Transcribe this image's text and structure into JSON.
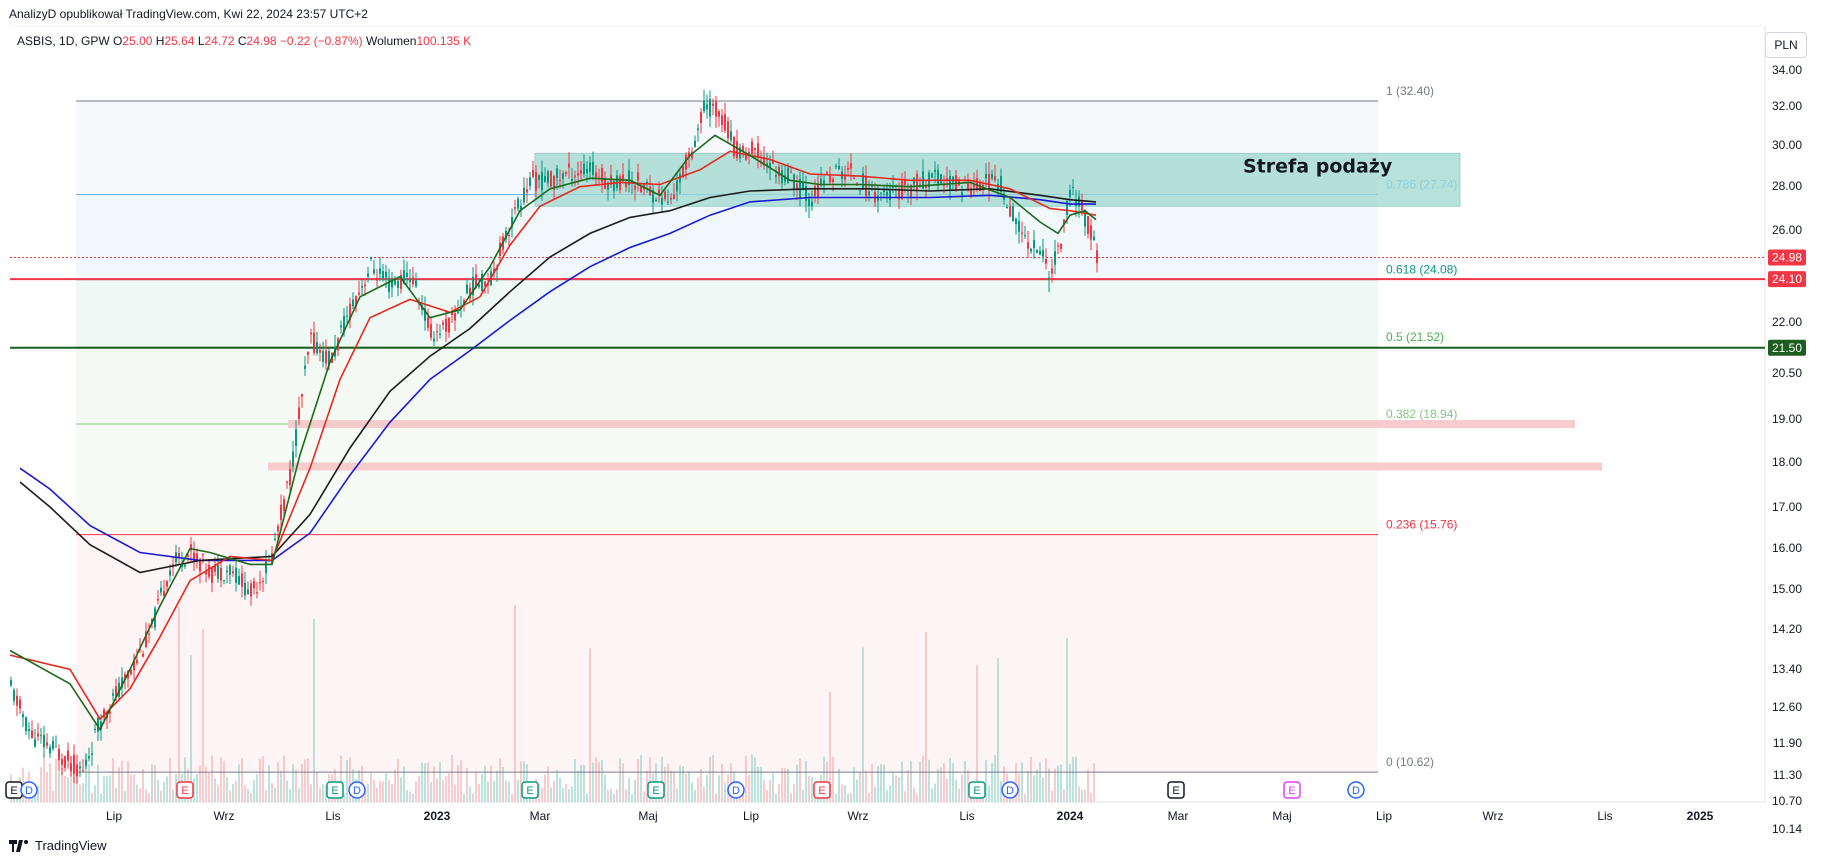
{
  "header": {
    "publisher_line": "AnalizyD opublikował TradingView.com, Kwi 22, 2024 23:57 UTC+2"
  },
  "symbol": {
    "name": "ASBIS, 1D, GPW",
    "open_label": "O",
    "open": "25.00",
    "high_label": "H",
    "high": "25.64",
    "low_label": "L",
    "low": "24.72",
    "close_label": "C",
    "close": "24.98",
    "change": "−0.22 (−0.87%)",
    "volume_label": "Wolumen",
    "volume": "100.135 K"
  },
  "currency": "PLN",
  "footer": {
    "brand": "TradingView"
  },
  "colors": {
    "up": "#089981",
    "down": "#f23645",
    "ema_green": "#1b6b1b",
    "ema_red": "#e8281e",
    "sma_black": "#1c1c1c",
    "sma_blue": "#1a1ad6",
    "zone": "#9fd8cf",
    "zone_border": "#7cc6ba"
  },
  "chart_data": {
    "type": "candlestick",
    "y_scale": "log",
    "y_ticks": [
      "34.00",
      "32.00",
      "30.00",
      "28.00",
      "26.00",
      "24.00",
      "22.00",
      "20.50",
      "19.00",
      "18.00",
      "17.00",
      "16.00",
      "15.00",
      "14.20",
      "13.40",
      "12.60",
      "11.90",
      "11.30",
      "10.70",
      "10.14"
    ],
    "x_ticks": [
      "Lip",
      "Wrz",
      "Lis",
      "2023",
      "Mar",
      "Maj",
      "Lip",
      "Wrz",
      "Lis",
      "2024",
      "Mar",
      "Maj",
      "Lip",
      "Wrz",
      "Lis",
      "2025"
    ],
    "fib_levels": [
      {
        "label": "1 (32.40)",
        "value": 32.4,
        "color": "#787b86"
      },
      {
        "label": "0.786 (27.74)",
        "value": 27.74,
        "color": "#64b5f6"
      },
      {
        "label": "0.618 (24.08)",
        "value": 24.08,
        "color": "#089981"
      },
      {
        "label": "0.5 (21.52)",
        "value": 21.52,
        "color": "#4caf50"
      },
      {
        "label": "0.382 (18.94)",
        "value": 18.94,
        "color": "#81c784"
      },
      {
        "label": "0.236 (15.76)",
        "value": 15.76,
        "color": "#f23645"
      },
      {
        "label": "0 (10.62)",
        "value": 10.62,
        "color": "#787b86"
      }
    ],
    "annotation": "Strefa podaży",
    "supply_zone": {
      "from": 27.2,
      "to": 29.7
    },
    "horizontal_lines": [
      {
        "value": 24.1,
        "label": "24.10",
        "color": "#f23645"
      },
      {
        "value": 21.5,
        "label": "21.50",
        "color": "#1b5e20"
      }
    ],
    "support_bands": [
      18.94,
      17.65
    ],
    "last_price": {
      "value": 24.98,
      "label": "24.98",
      "color": "#f23645"
    },
    "event_markers": [
      {
        "t": "E",
        "c": "#131722"
      },
      {
        "t": "D",
        "c": "#2962ff"
      },
      {
        "t": "E",
        "c": "#f23645"
      },
      {
        "t": "E",
        "c": "#089981"
      },
      {
        "t": "D",
        "c": "#2962ff"
      },
      {
        "t": "E",
        "c": "#089981"
      },
      {
        "t": "E",
        "c": "#089981"
      },
      {
        "t": "D",
        "c": "#2962ff"
      },
      {
        "t": "E",
        "c": "#f23645"
      },
      {
        "t": "E",
        "c": "#089981"
      },
      {
        "t": "D",
        "c": "#2962ff"
      },
      {
        "t": "E",
        "c": "#131722"
      },
      {
        "t": "E",
        "c": "#e040fb"
      },
      {
        "t": "D",
        "c": "#2962ff"
      }
    ],
    "price_path": [
      [
        0,
        12.2
      ],
      [
        20,
        11.3
      ],
      [
        45,
        11.0
      ],
      [
        72,
        10.62
      ],
      [
        90,
        11.6
      ],
      [
        115,
        12.4
      ],
      [
        140,
        13.4
      ],
      [
        160,
        15.0
      ],
      [
        180,
        15.3
      ],
      [
        200,
        14.8
      ],
      [
        220,
        14.9
      ],
      [
        240,
        14.3
      ],
      [
        260,
        15.1
      ],
      [
        280,
        17.5
      ],
      [
        300,
        21.8
      ],
      [
        320,
        21.0
      ],
      [
        340,
        23.0
      ],
      [
        360,
        24.6
      ],
      [
        380,
        23.8
      ],
      [
        400,
        24.3
      ],
      [
        420,
        22.0
      ],
      [
        440,
        22.4
      ],
      [
        460,
        23.8
      ],
      [
        480,
        24.2
      ],
      [
        500,
        26.5
      ],
      [
        520,
        28.4
      ],
      [
        540,
        28.4
      ],
      [
        560,
        28.8
      ],
      [
        580,
        28.9
      ],
      [
        600,
        28.3
      ],
      [
        620,
        28.5
      ],
      [
        640,
        27.9
      ],
      [
        660,
        27.4
      ],
      [
        680,
        29.8
      ],
      [
        695,
        32.2
      ],
      [
        710,
        31.8
      ],
      [
        725,
        29.8
      ],
      [
        745,
        29.8
      ],
      [
        765,
        28.9
      ],
      [
        785,
        28.3
      ],
      [
        800,
        27.5
      ],
      [
        820,
        28.7
      ],
      [
        840,
        28.8
      ],
      [
        860,
        27.9
      ],
      [
        880,
        27.7
      ],
      [
        900,
        28.1
      ],
      [
        920,
        28.5
      ],
      [
        940,
        28.3
      ],
      [
        960,
        28.1
      ],
      [
        975,
        28.4
      ],
      [
        990,
        28.2
      ],
      [
        1010,
        26.0
      ],
      [
        1030,
        25.2
      ],
      [
        1040,
        24.3
      ],
      [
        1050,
        25.7
      ],
      [
        1060,
        28.0
      ],
      [
        1070,
        27.2
      ],
      [
        1080,
        26.0
      ],
      [
        1086,
        24.98
      ]
    ],
    "ma_ema_green": [
      [
        0,
        13.0
      ],
      [
        60,
        12.3
      ],
      [
        90,
        11.4
      ],
      [
        120,
        12.6
      ],
      [
        150,
        14.0
      ],
      [
        180,
        15.4
      ],
      [
        200,
        15.3
      ],
      [
        240,
        15.0
      ],
      [
        262,
        15.0
      ],
      [
        290,
        18.0
      ],
      [
        320,
        21.0
      ],
      [
        350,
        23.4
      ],
      [
        390,
        24.2
      ],
      [
        420,
        22.6
      ],
      [
        450,
        22.9
      ],
      [
        480,
        24.6
      ],
      [
        510,
        27.0
      ],
      [
        540,
        28.0
      ],
      [
        580,
        28.5
      ],
      [
        620,
        28.4
      ],
      [
        650,
        27.7
      ],
      [
        680,
        29.6
      ],
      [
        705,
        30.6
      ],
      [
        740,
        29.6
      ],
      [
        780,
        28.4
      ],
      [
        810,
        28.2
      ],
      [
        850,
        28.2
      ],
      [
        900,
        28.1
      ],
      [
        960,
        28.3
      ],
      [
        1000,
        27.6
      ],
      [
        1030,
        26.5
      ],
      [
        1048,
        26.0
      ],
      [
        1060,
        26.8
      ],
      [
        1075,
        27.0
      ],
      [
        1086,
        26.6
      ]
    ],
    "ma_ema_red": [
      [
        0,
        12.9
      ],
      [
        60,
        12.6
      ],
      [
        90,
        11.6
      ],
      [
        120,
        12.2
      ],
      [
        150,
        13.3
      ],
      [
        180,
        14.6
      ],
      [
        220,
        15.2
      ],
      [
        262,
        15.1
      ],
      [
        300,
        17.6
      ],
      [
        330,
        20.4
      ],
      [
        360,
        22.6
      ],
      [
        400,
        23.3
      ],
      [
        440,
        22.8
      ],
      [
        470,
        23.4
      ],
      [
        500,
        25.5
      ],
      [
        530,
        27.2
      ],
      [
        570,
        28.1
      ],
      [
        610,
        28.3
      ],
      [
        650,
        28.2
      ],
      [
        690,
        28.9
      ],
      [
        720,
        29.8
      ],
      [
        760,
        29.4
      ],
      [
        800,
        28.7
      ],
      [
        850,
        28.6
      ],
      [
        900,
        28.4
      ],
      [
        960,
        28.4
      ],
      [
        1000,
        28.0
      ],
      [
        1040,
        27.1
      ],
      [
        1060,
        27.0
      ],
      [
        1086,
        26.8
      ]
    ],
    "ma_sma_black": [
      [
        10,
        17.2
      ],
      [
        40,
        16.5
      ],
      [
        80,
        15.5
      ],
      [
        130,
        14.8
      ],
      [
        190,
        15.1
      ],
      [
        262,
        15.2
      ],
      [
        300,
        16.3
      ],
      [
        340,
        18.2
      ],
      [
        380,
        20.0
      ],
      [
        420,
        21.2
      ],
      [
        460,
        22.2
      ],
      [
        500,
        23.6
      ],
      [
        540,
        25.0
      ],
      [
        580,
        26.0
      ],
      [
        620,
        26.7
      ],
      [
        660,
        27.0
      ],
      [
        700,
        27.6
      ],
      [
        740,
        27.9
      ],
      [
        800,
        28.0
      ],
      [
        860,
        28.0
      ],
      [
        920,
        27.9
      ],
      [
        980,
        28.0
      ],
      [
        1030,
        27.7
      ],
      [
        1060,
        27.5
      ],
      [
        1086,
        27.4
      ]
    ],
    "ma_sma_blue": [
      [
        10,
        17.6
      ],
      [
        40,
        17.0
      ],
      [
        80,
        16.0
      ],
      [
        130,
        15.3
      ],
      [
        190,
        15.1
      ],
      [
        262,
        15.1
      ],
      [
        300,
        15.8
      ],
      [
        340,
        17.4
      ],
      [
        380,
        19.0
      ],
      [
        420,
        20.4
      ],
      [
        460,
        21.4
      ],
      [
        500,
        22.5
      ],
      [
        540,
        23.6
      ],
      [
        580,
        24.6
      ],
      [
        620,
        25.4
      ],
      [
        660,
        26.0
      ],
      [
        700,
        26.8
      ],
      [
        740,
        27.4
      ],
      [
        800,
        27.6
      ],
      [
        860,
        27.6
      ],
      [
        920,
        27.6
      ],
      [
        980,
        27.7
      ],
      [
        1030,
        27.5
      ],
      [
        1060,
        27.3
      ],
      [
        1086,
        27.3
      ]
    ]
  }
}
